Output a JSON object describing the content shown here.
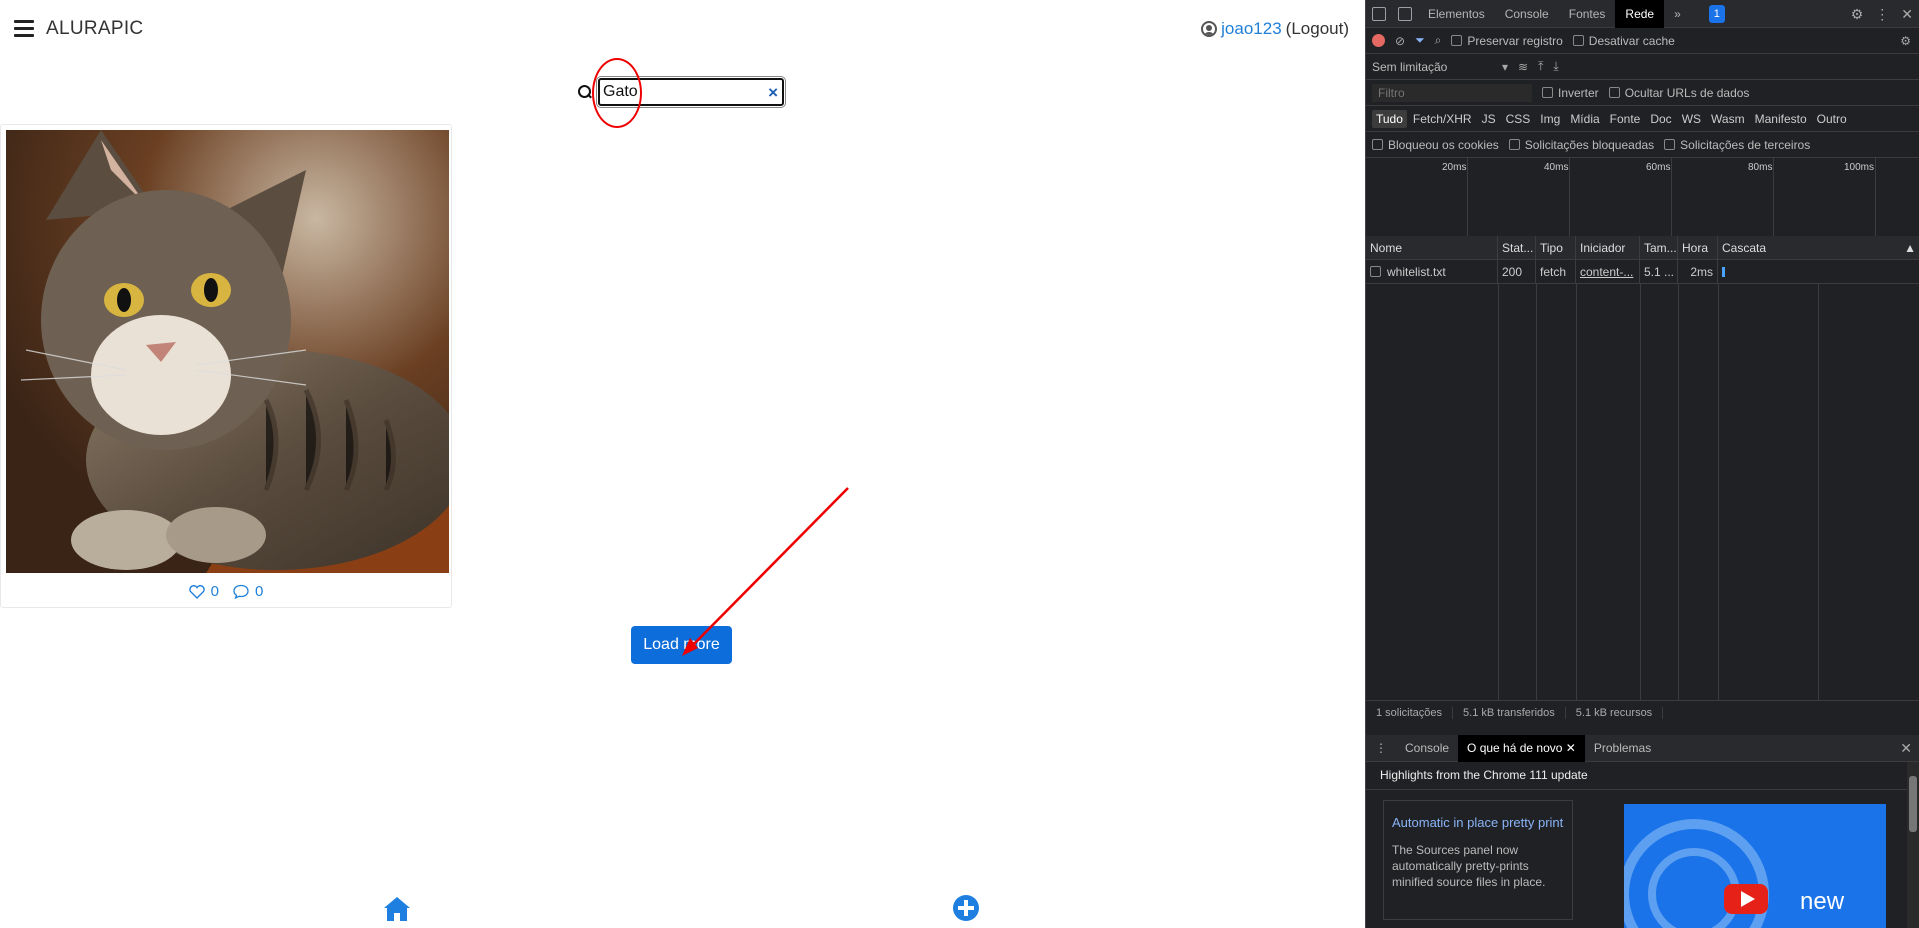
{
  "header": {
    "brand": "ALURAPIC",
    "username": "joao123",
    "logout": "(Logout)"
  },
  "search": {
    "value": "Gato"
  },
  "photo_card": {
    "likes": "0",
    "comments": "0"
  },
  "load_more_label": "Load more",
  "devtools": {
    "tabs": [
      "Elementos",
      "Console",
      "Fontes",
      "Rede"
    ],
    "active_tab": "Rede",
    "issue_count": "1",
    "toolbar": {
      "preserve_log": "Preservar registro",
      "disable_cache": "Desativar cache",
      "throttling": "Sem limitação"
    },
    "filter": {
      "placeholder": "Filtro",
      "invert": "Inverter",
      "hide_data_urls": "Ocultar URLs de dados"
    },
    "type_filters": [
      "Tudo",
      "Fetch/XHR",
      "JS",
      "CSS",
      "Img",
      "Mídia",
      "Fonte",
      "Doc",
      "WS",
      "Wasm",
      "Manifesto",
      "Outro"
    ],
    "options": [
      "Bloqueou os cookies",
      "Solicitações bloqueadas",
      "Solicitações de terceiros"
    ],
    "timeline_ticks": [
      "20ms",
      "40ms",
      "60ms",
      "80ms",
      "100ms"
    ],
    "columns": [
      "Nome",
      "Stat...",
      "Tipo",
      "Iniciador",
      "Tam...",
      "Hora",
      "Cascata"
    ],
    "rows": [
      {
        "name": "whitelist.txt",
        "status": "200",
        "type": "fetch",
        "initiator": "content-...",
        "size": "5.1 ...",
        "time": "2ms"
      }
    ],
    "summary": [
      "1 solicitações",
      "5.1 kB transferidos",
      "5.1 kB recursos"
    ],
    "drawer_tabs": [
      "Console",
      "O que há de novo",
      "Problemas"
    ],
    "whats_new": {
      "heading": "Highlights from the Chrome 111 update",
      "card_title": "Automatic in place pretty print",
      "card_desc": "The Sources panel now automatically pretty-prints minified source files in place.",
      "image_label": "new"
    }
  },
  "colors": {
    "accent": "#0d6edb",
    "annotation": "#e00000",
    "devtools_bg": "#202124"
  }
}
